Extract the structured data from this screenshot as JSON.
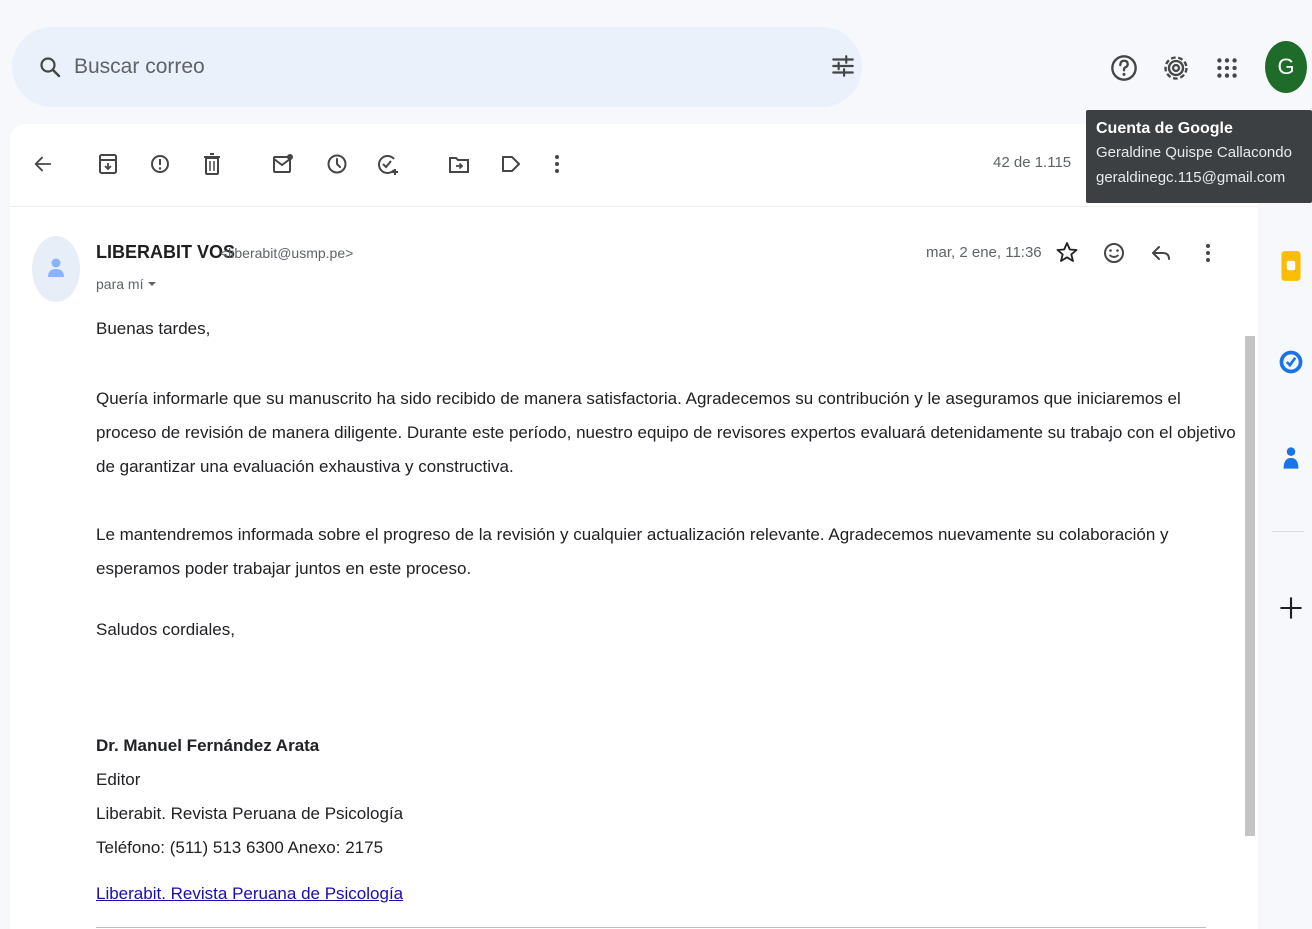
{
  "search": {
    "placeholder": "Buscar correo"
  },
  "toolbar": {
    "counter": "42 de 1.115"
  },
  "tooltip": {
    "title": "Cuenta de Google",
    "name": "Geraldine Quispe Callacondo",
    "email": "geraldinegc.115@gmail.com"
  },
  "account": {
    "avatar_letter": "G",
    "avatar_color": "#1e6b2a"
  },
  "message": {
    "sender_name": "LIBERABIT VOS",
    "sender_email": "<liberabit@usmp.pe>",
    "to_label": "para mí",
    "date": "mar, 2 ene, 11:36",
    "greeting": "Buenas tardes,",
    "paragraph1": "Quería informarle que su manuscrito ha sido recibido de manera satisfactoria. Agradecemos su contribución y le aseguramos que iniciaremos el proceso de revisión de manera diligente. Durante este período, nuestro equipo de revisores expertos evaluará detenidamente su trabajo con el objetivo de garantizar una evaluación exhaustiva y constructiva.",
    "paragraph2": "Le mantendremos informada sobre el progreso de la revisión y cualquier actualización relevante. Agradecemos nuevamente su colaboración y esperamos poder trabajar juntos en este proceso.",
    "closing": "Saludos cordiales,",
    "signature": {
      "name": "Dr. Manuel Fernández Arata",
      "role": "Editor",
      "org": "Liberabit. Revista Peruana de Psicología",
      "phone": "Teléfono: (511) 513 6300 Anexo: 2175",
      "link": "Liberabit. Revista Peruana de Psicología"
    }
  },
  "icons": {
    "top": [
      "help-icon",
      "settings-icon",
      "apps-icon"
    ],
    "toolbar": [
      "back-icon",
      "archive-icon",
      "report-spam-icon",
      "delete-icon",
      "mark-unread-icon",
      "snooze-icon",
      "add-task-icon",
      "move-to-icon",
      "label-icon",
      "more-icon"
    ],
    "side": [
      "keep-icon",
      "tasks-icon",
      "contacts-icon",
      "add-icon"
    ]
  },
  "colors": {
    "keep": "#fbbc04",
    "tasks": "#1a73e8",
    "contacts": "#1a73e8",
    "link": "#1a0dab"
  }
}
